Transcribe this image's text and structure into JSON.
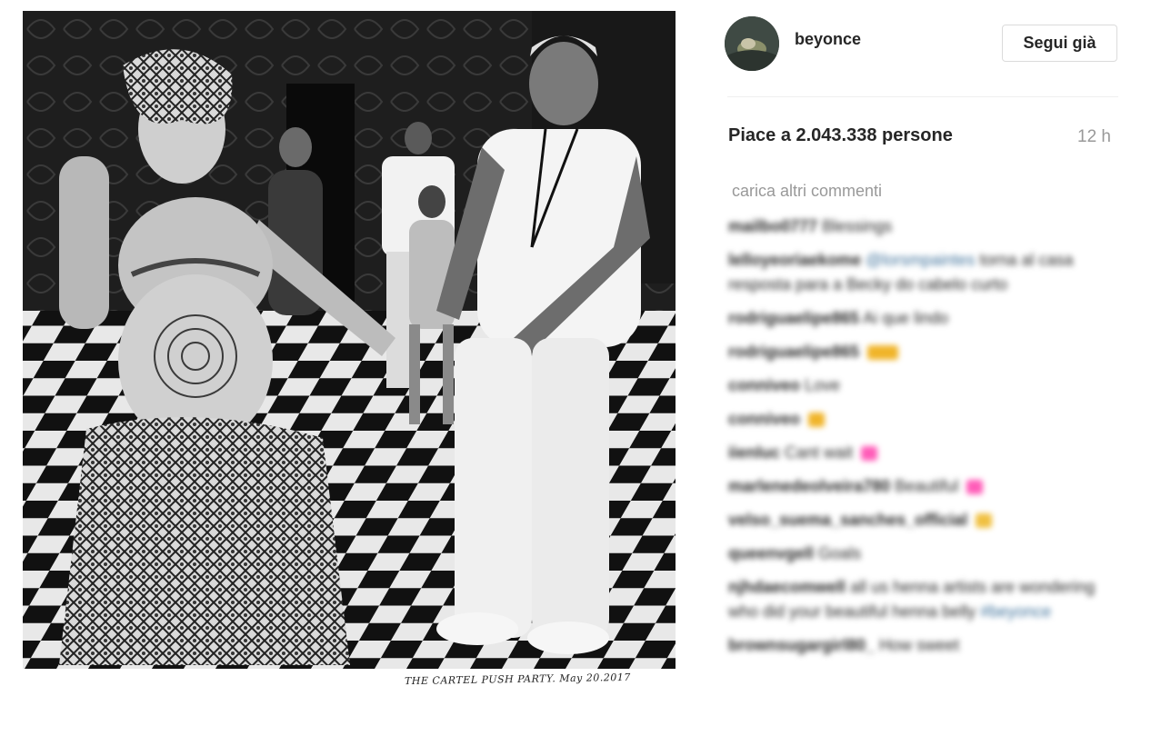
{
  "photo": {
    "caption": "THE CARTEL PUSH PARTY. May 20.2017"
  },
  "post": {
    "username": "beyonce",
    "follow_label": "Segui già",
    "likes_text": "Piace a 2.043.338 persone",
    "timestamp": "12 h",
    "load_more": "carica altri commenti"
  },
  "comments": [
    {
      "user": "mailbo0777",
      "text": "Blessings",
      "mention": "",
      "emoji": ""
    },
    {
      "user": "lelloyeoriaekome",
      "text": "torna al casa resposta para a Becky do cabelo curto",
      "mention": "@lorsmpaintes",
      "emoji": ""
    },
    {
      "user": "rodriguaelipe865",
      "text": "Ai que lindo",
      "mention": "",
      "emoji": ""
    },
    {
      "user": "rodriguaelipe865",
      "text": "",
      "mention": "",
      "emoji": "#f0b429"
    },
    {
      "user": "conniveo",
      "text": "Love",
      "mention": "",
      "emoji": ""
    },
    {
      "user": "conniveo",
      "text": "",
      "mention": "",
      "emoji": "#f0b429"
    },
    {
      "user": "iienluc",
      "text": "Cant wait",
      "mention": "",
      "emoji": "#ff5cb8"
    },
    {
      "user": "marlenedeolveira780",
      "text": "Beautiful",
      "mention": "",
      "emoji": "#ff5cb8"
    },
    {
      "user": "velso_suema_sanches_official",
      "text": "",
      "mention": "",
      "emoji": "#f0c040"
    },
    {
      "user": "queenvgell",
      "text": "Goals",
      "mention": "",
      "emoji": ""
    },
    {
      "user": "njhdaecomwell",
      "text": "all us henna artists are wondering who did your beautiful henna belly",
      "mention": "#beyonce",
      "emoji": ""
    },
    {
      "user": "brownsugargirl80_",
      "text": "How sweet",
      "mention": "",
      "emoji": ""
    }
  ]
}
